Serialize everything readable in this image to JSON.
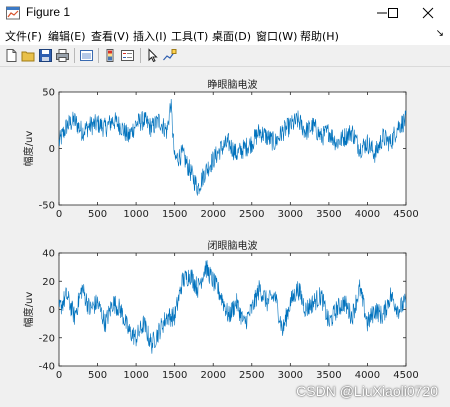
{
  "window": {
    "title": "Figure 1"
  },
  "menu": [
    "文件(F)",
    "编辑(E)",
    "查看(V)",
    "插入(I)",
    "工具(T)",
    "桌面(D)",
    "窗口(W)",
    "帮助(H)"
  ],
  "toolbar_icons": [
    "new-figure-icon",
    "open-file-icon",
    "save-icon",
    "print-icon",
    "link-plot-icon",
    "colorbar-icon",
    "legend-icon",
    "edit-plot-icon",
    "data-cursor-icon"
  ],
  "watermark": "CSDN @LiuXiaoli0720",
  "colors": {
    "line": "#0072bd",
    "axes_bg": "#ffffff",
    "figure_bg": "#f0f0f0"
  },
  "chart_data": [
    {
      "type": "line",
      "title": "睁眼脑电波",
      "xlabel": "",
      "ylabel": "幅度/uv",
      "xlim": [
        0,
        4500
      ],
      "ylim": [
        -50,
        50
      ],
      "xticks": [
        "0",
        "500",
        "1000",
        "1500",
        "2000",
        "2500",
        "3000",
        "3500",
        "4000",
        "4500"
      ],
      "yticks": [
        "-50",
        "0",
        "50"
      ],
      "series": [
        {
          "x": [
            0,
            100,
            200,
            300,
            400,
            500,
            600,
            700,
            800,
            900,
            1000,
            1100,
            1200,
            1300,
            1400,
            1450,
            1500,
            1600,
            1700,
            1800,
            1900,
            2000,
            2100,
            2200,
            2300,
            2400,
            2500,
            2600,
            2700,
            2800,
            2900,
            3000,
            3100,
            3200,
            3300,
            3400,
            3500,
            3600,
            3700,
            3800,
            3900,
            4000,
            4100,
            4200,
            4300,
            4400,
            4500
          ],
          "y": [
            5,
            20,
            25,
            15,
            20,
            22,
            18,
            25,
            20,
            10,
            22,
            25,
            18,
            25,
            15,
            40,
            -10,
            -5,
            -20,
            -35,
            -20,
            -10,
            0,
            5,
            -5,
            0,
            5,
            15,
            10,
            5,
            15,
            20,
            25,
            15,
            20,
            10,
            15,
            5,
            10,
            15,
            0,
            5,
            -5,
            10,
            5,
            20,
            25
          ]
        }
      ]
    },
    {
      "type": "line",
      "title": "闭眼脑电波",
      "xlabel": "",
      "ylabel": "幅度/uv",
      "xlim": [
        0,
        4500
      ],
      "ylim": [
        -40,
        40
      ],
      "xticks": [
        "0",
        "500",
        "1000",
        "1500",
        "2000",
        "2500",
        "3000",
        "3500",
        "4000",
        "4500"
      ],
      "yticks": [
        "-40",
        "-20",
        "0",
        "20",
        "40"
      ],
      "series": [
        {
          "x": [
            0,
            100,
            200,
            300,
            400,
            500,
            600,
            700,
            800,
            900,
            1000,
            1100,
            1200,
            1300,
            1400,
            1500,
            1600,
            1700,
            1800,
            1900,
            2000,
            2100,
            2200,
            2300,
            2400,
            2500,
            2600,
            2700,
            2800,
            2900,
            3000,
            3100,
            3200,
            3300,
            3400,
            3500,
            3600,
            3700,
            3800,
            3900,
            4000,
            4100,
            4200,
            4300,
            4400,
            4500
          ],
          "y": [
            0,
            10,
            -5,
            15,
            0,
            5,
            -10,
            5,
            0,
            -15,
            -20,
            -10,
            -25,
            -15,
            -5,
            -5,
            20,
            25,
            15,
            30,
            20,
            10,
            -5,
            5,
            -10,
            0,
            15,
            5,
            10,
            -15,
            5,
            15,
            0,
            5,
            10,
            -10,
            0,
            5,
            -5,
            15,
            -10,
            0,
            -5,
            10,
            0,
            5
          ]
        }
      ]
    }
  ]
}
